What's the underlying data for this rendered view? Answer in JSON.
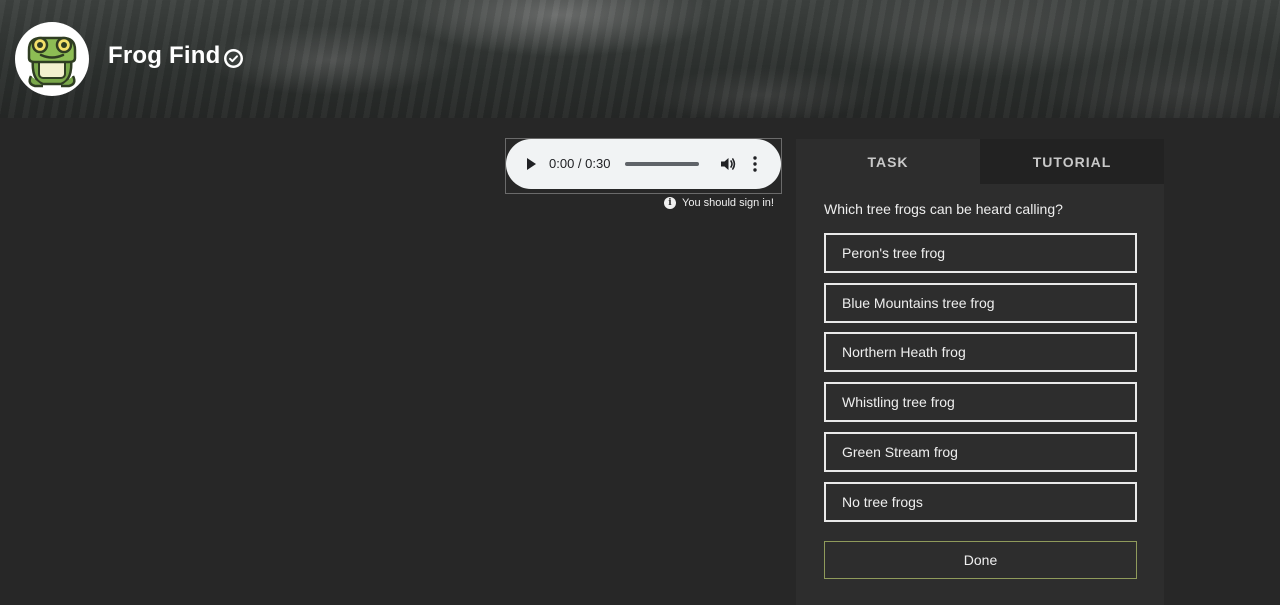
{
  "project": {
    "title": "Frog Find"
  },
  "audio": {
    "time": "0:00 / 0:30",
    "progress": 0
  },
  "notice": {
    "text": "You should sign in!"
  },
  "tabs": [
    {
      "label": "TASK"
    },
    {
      "label": "TUTORIAL"
    }
  ],
  "task": {
    "question": "Which tree frogs can be heard calling?",
    "answers": [
      {
        "label": "Peron's tree frog"
      },
      {
        "label": "Blue Mountains tree frog"
      },
      {
        "label": "Northern Heath frog"
      },
      {
        "label": "Whistling tree frog"
      },
      {
        "label": "Green Stream frog"
      },
      {
        "label": "No tree frogs"
      }
    ],
    "done_label": "Done"
  },
  "colors": {
    "background": "#272727",
    "panel": "#2d2d2d",
    "done_border": "#8f9a5b"
  },
  "icons": {
    "avatar": "frog-icon",
    "verified": "check-badge-icon",
    "play": "play-icon",
    "volume": "volume-icon",
    "more": "more-vertical-icon",
    "info": "info-icon"
  }
}
